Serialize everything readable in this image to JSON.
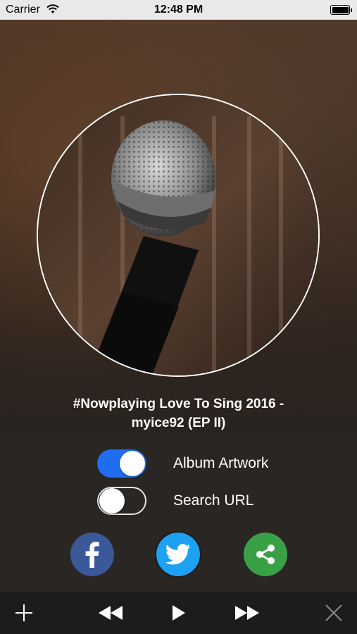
{
  "status_bar": {
    "carrier": "Carrier",
    "time": "12:48 PM"
  },
  "now_playing": {
    "title": "#Nowplaying Love To Sing 2016 -\nmyice92 (EP II)"
  },
  "options": [
    {
      "label": "Album Artwork",
      "enabled": true
    },
    {
      "label": "Search URL",
      "enabled": false
    }
  ],
  "share": [
    {
      "name": "facebook",
      "icon": "facebook-icon",
      "color": "#3b5998"
    },
    {
      "name": "twitter",
      "icon": "twitter-bird-icon",
      "color": "#1da1f2"
    },
    {
      "name": "share",
      "icon": "share-icon",
      "color": "#3aa046"
    }
  ],
  "player_controls": [
    "plus-icon",
    "rewind-icon",
    "play-icon",
    "fast-forward-icon",
    "close-icon"
  ],
  "colors": {
    "toggle_on": "#1f6ef1",
    "panel_bg": "#2a2623",
    "status_bar_bg": "#e9e9e9"
  }
}
